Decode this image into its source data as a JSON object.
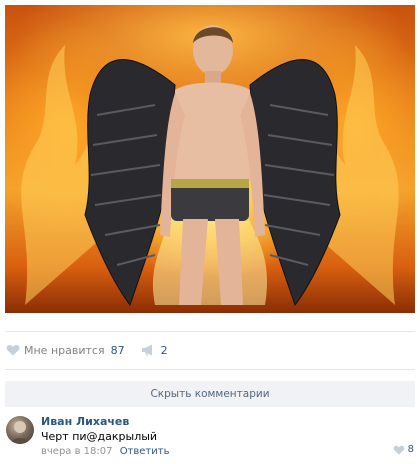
{
  "post": {
    "photo_alt": "",
    "likes_label": "Мне нравится",
    "likes_count": "87",
    "reposts_count": "2"
  },
  "comments": {
    "hide_label": "Скрыть комментарии",
    "items": [
      {
        "author": "Иван Лихачев",
        "text": "Черт пи@дакрылый",
        "time": "вчера в 18:07",
        "reply_label": "Ответить",
        "likes": "8"
      }
    ]
  },
  "icons": {
    "like": "heart-icon",
    "repost": "megaphone-icon"
  },
  "colors": {
    "link": "#2a5885",
    "muted": "#828282",
    "bar": "#f0f2f5"
  }
}
